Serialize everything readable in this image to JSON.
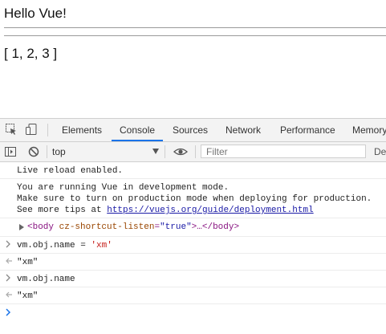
{
  "page": {
    "heading": "Hello Vue!",
    "array_text": "[ 1, 2, 3 ]"
  },
  "devtools": {
    "tabs": [
      "Elements",
      "Console",
      "Sources",
      "Network",
      "Performance",
      "Memory"
    ],
    "active_tab": "Console",
    "toolbar": {
      "context": "top",
      "filter_placeholder": "Filter",
      "levels_label": "De"
    },
    "console": {
      "live_reload": "Live reload enabled.",
      "vue_msg_line1": "You are running Vue in development mode.",
      "vue_msg_line2": "Make sure to turn on production mode when deploying for production.",
      "vue_msg_line3_prefix": "See more tips at ",
      "vue_msg_link": "https://vuejs.org/guide/deployment.html",
      "body_open": "<body",
      "body_attr": "cz-shortcut-listen",
      "body_attr_value": "\"true\"",
      "body_rest": ">…</body>",
      "input1": "vm.obj.name = 'xm'",
      "input1_code": "vm.obj.name = ",
      "input1_str": "'xm'",
      "output1": "\"xm\"",
      "input2": "vm.obj.name",
      "output2": "\"xm\""
    }
  }
}
